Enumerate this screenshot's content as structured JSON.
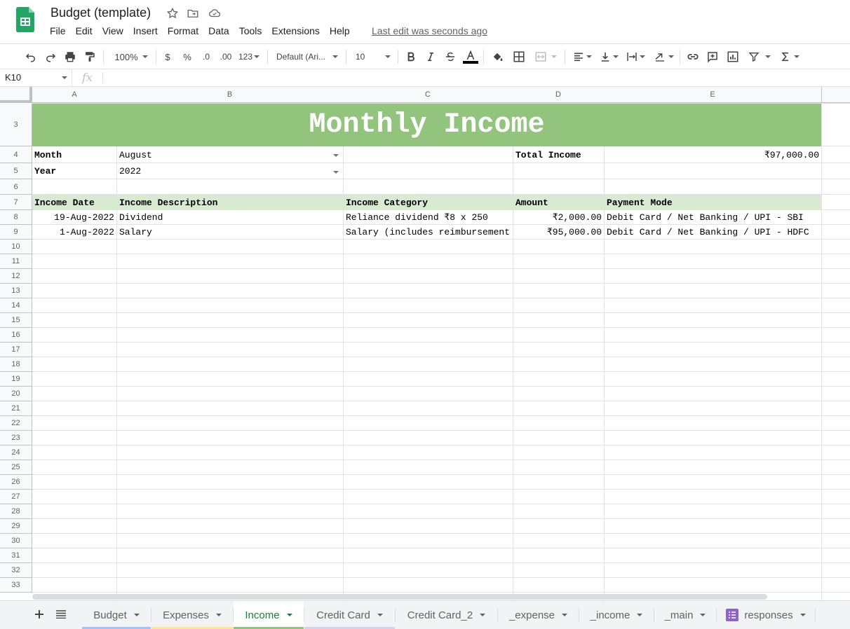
{
  "app": {
    "title": "Budget (template)",
    "last_edit": "Last edit was seconds ago",
    "menu": [
      "File",
      "Edit",
      "View",
      "Insert",
      "Format",
      "Data",
      "Tools",
      "Extensions",
      "Help"
    ]
  },
  "toolbar": {
    "zoom": "100%",
    "currency": "$",
    "percent": "%",
    "decrease_decimal": ".0",
    "increase_decimal": ".00",
    "number_format": "123",
    "font": "Default (Ari...",
    "font_size": "10"
  },
  "formula_bar": {
    "name_box": "K10",
    "fx": "fx",
    "value": ""
  },
  "columns": [
    "A",
    "B",
    "C",
    "D",
    "E"
  ],
  "rows": [
    "3",
    "4",
    "5",
    "6",
    "7",
    "8",
    "9",
    "10",
    "11",
    "12",
    "13",
    "14",
    "15",
    "16",
    "17",
    "18",
    "19",
    "20",
    "21",
    "22",
    "23",
    "24",
    "25",
    "26",
    "27",
    "28",
    "29",
    "30",
    "31",
    "32",
    "33"
  ],
  "sheet": {
    "title": "Monthly Income",
    "month_label": "Month",
    "month_value": "August",
    "year_label": "Year",
    "year_value": "2022",
    "total_label": "Total Income",
    "total_value": "₹97,000.00",
    "table_headers": [
      "Income Date",
      "Income Description",
      "Income Category",
      "Amount",
      "Payment Mode"
    ],
    "table_rows": [
      [
        "19-Aug-2022",
        "Dividend",
        "Reliance dividend ₹8 x 250",
        "₹2,000.00",
        "Debit Card / Net Banking / UPI - SBI"
      ],
      [
        "1-Aug-2022",
        "Salary",
        "Salary (includes reimbursement",
        "₹95,000.00",
        "Debit Card / Net Banking / UPI - HDFC"
      ]
    ]
  },
  "tabs": [
    {
      "label": "Budget",
      "color": "#a4c2f4"
    },
    {
      "label": "Expenses",
      "color": "#ffe599"
    },
    {
      "label": "Income",
      "color": "#93c47d"
    },
    {
      "label": "Credit Card",
      "color": "#d9d2e9"
    },
    {
      "label": "Credit Card_2",
      "color": ""
    },
    {
      "label": "_expense",
      "color": ""
    },
    {
      "label": "_income",
      "color": ""
    },
    {
      "label": "_main",
      "color": ""
    },
    {
      "label": "responses",
      "color": "",
      "icon": "form-icon"
    }
  ],
  "colors": {
    "title_band": "#93c47d",
    "header_band": "#d9ead3",
    "active_tab_text": "#188038"
  }
}
